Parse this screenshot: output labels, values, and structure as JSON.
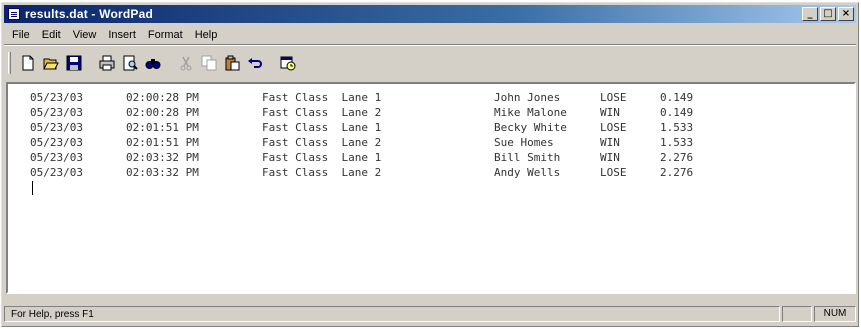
{
  "window": {
    "title": "results.dat - WordPad",
    "buttons": [
      "0",
      "1",
      "r"
    ]
  },
  "menu": [
    "File",
    "Edit",
    "View",
    "Insert",
    "Format",
    "Help"
  ],
  "toolbar": {
    "icons": [
      "new-icon",
      "open-icon",
      "save-icon",
      "print-icon",
      "print-preview-icon",
      "find-icon",
      "cut-icon",
      "copy-icon",
      "paste-icon",
      "undo-icon",
      "date-time-icon"
    ]
  },
  "document": {
    "rows": [
      {
        "date": "05/23/03",
        "time": "02:00:28 PM",
        "race": "Fast Class  Lane 1",
        "name": "John Jones",
        "result": "LOSE",
        "elapsed": "0.149"
      },
      {
        "date": "05/23/03",
        "time": "02:00:28 PM",
        "race": "Fast Class  Lane 2",
        "name": "Mike Malone",
        "result": "WIN",
        "elapsed": "0.149"
      },
      {
        "date": "05/23/03",
        "time": "02:01:51 PM",
        "race": "Fast Class  Lane 1",
        "name": "Becky White",
        "result": "LOSE",
        "elapsed": "1.533"
      },
      {
        "date": "05/23/03",
        "time": "02:01:51 PM",
        "race": "Fast Class  Lane 2",
        "name": "Sue Homes",
        "result": "WIN",
        "elapsed": "1.533"
      },
      {
        "date": "05/23/03",
        "time": "02:03:32 PM",
        "race": "Fast Class  Lane 1",
        "name": "Bill Smith",
        "result": "WIN",
        "elapsed": "2.276"
      },
      {
        "date": "05/23/03",
        "time": "02:03:32 PM",
        "race": "Fast Class  Lane 2",
        "name": "Andy Wells",
        "result": "LOSE",
        "elapsed": "2.276"
      }
    ]
  },
  "status": {
    "help_text": "For Help, press F1",
    "num_indicator": "NUM"
  },
  "colors": {
    "title_start": "#0a246a",
    "title_end": "#a6caf0",
    "face": "#d4d0c8"
  }
}
